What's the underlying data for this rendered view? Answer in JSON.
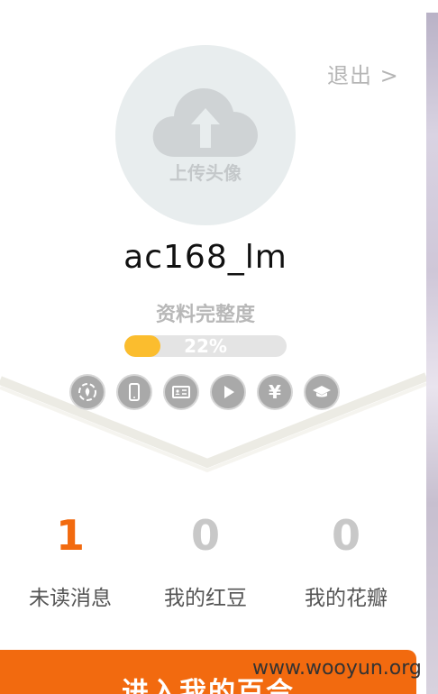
{
  "header": {
    "logout_label": "退出 >"
  },
  "avatar": {
    "upload_label": "上传头像"
  },
  "profile": {
    "username": "ac168_lm",
    "completion_label": "资料完整度",
    "completion_percent_text": "22%",
    "completion_fraction": 0.22
  },
  "badges": [
    {
      "icon": "identity-icon"
    },
    {
      "icon": "phone-icon"
    },
    {
      "icon": "id-card-icon"
    },
    {
      "icon": "video-icon"
    },
    {
      "icon": "yuan-icon",
      "glyph": "¥"
    },
    {
      "icon": "graduation-cap-icon"
    }
  ],
  "stats": [
    {
      "value": "1",
      "label": "未读消息",
      "color": "#f26a0f"
    },
    {
      "value": "0",
      "label": "我的红豆",
      "color": "#c8c8c8"
    },
    {
      "value": "0",
      "label": "我的花瓣",
      "color": "#c8c8c8"
    }
  ],
  "enter_button": {
    "label": "进入我的百合"
  },
  "watermark": "www.wooyun.org",
  "colors": {
    "accent": "#f26a0f",
    "progress": "#fbbd2e"
  }
}
